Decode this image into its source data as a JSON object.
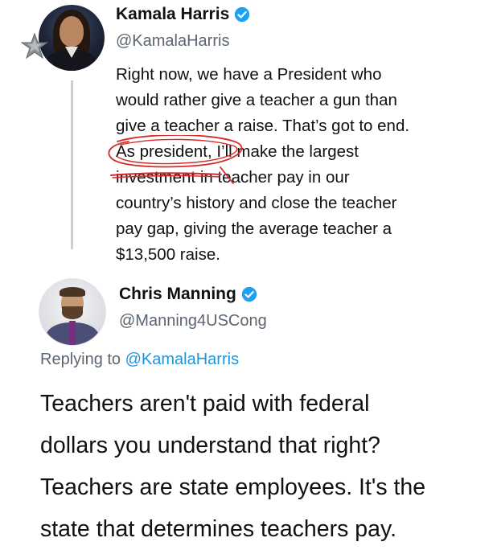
{
  "tweets": [
    {
      "author": {
        "name": "Kamala Harris",
        "handle": "@KamalaHarris",
        "verified": true
      },
      "text_lines": [
        "Right now, we have a President who",
        "would rather give a teacher a gun than",
        "give a teacher a raise. That’s got to end.",
        "As president, I’ll make the largest",
        "investment in teacher pay in our",
        "country’s history and close the teacher",
        "pay gap, giving the average teacher a",
        "$13,500 raise."
      ]
    },
    {
      "author": {
        "name": "Chris Manning",
        "handle": "@Manning4USCong",
        "verified": true
      },
      "replying_prefix": "Replying to",
      "replying_to": "@KamalaHarris",
      "text_lines": [
        "Teachers aren't paid with federal",
        "dollars you understand that right?",
        "Teachers are state employees. It's the",
        "state that determines teachers pay."
      ]
    }
  ],
  "icons": {
    "verified": "verified-badge-icon",
    "badge": "star-icon"
  },
  "colors": {
    "verified_blue": "#1da1f2",
    "mention_blue": "#1b95e0",
    "secondary_text": "#5b6670",
    "annotation_red": "#d62b2b",
    "thread_line": "#c8d0d6"
  }
}
